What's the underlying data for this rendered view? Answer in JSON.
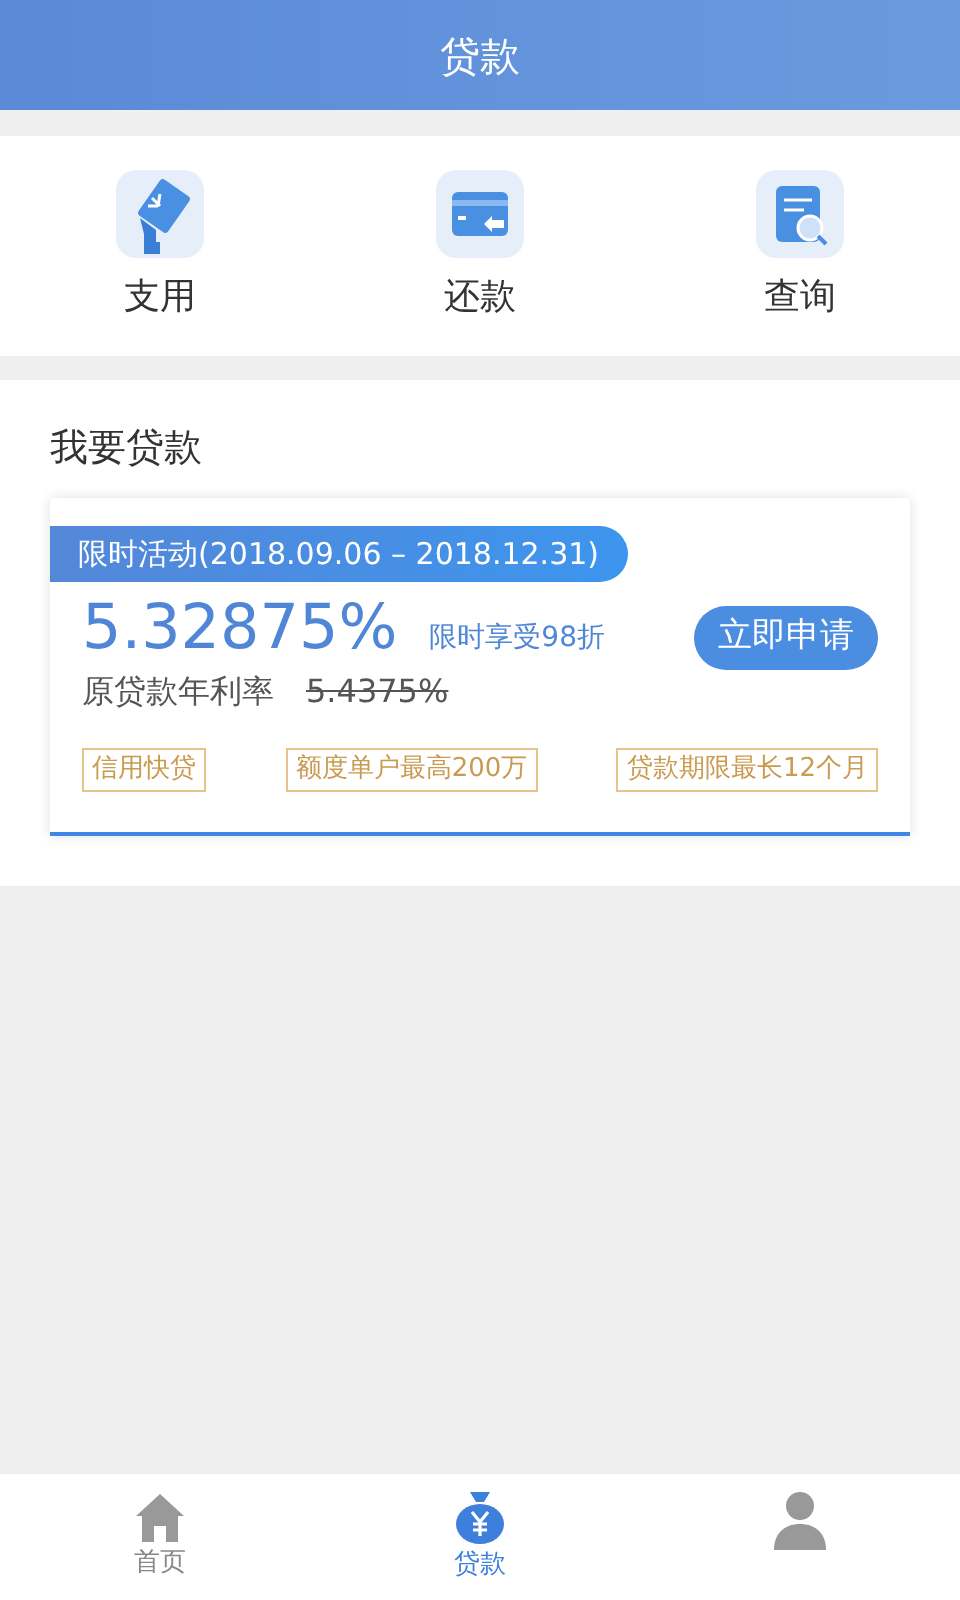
{
  "header": {
    "title": "贷款"
  },
  "actions": [
    {
      "label": "支用"
    },
    {
      "label": "还款"
    },
    {
      "label": "查询"
    }
  ],
  "loan_section": {
    "title": "我要贷款",
    "offer": {
      "promo": "限时活动(2018.09.06 – 2018.12.31)",
      "rate": "5.32875%",
      "discount": "限时享受98折",
      "apply_button": "立即申请",
      "original_label": "原贷款年利率",
      "original_rate": "5.4375%",
      "tags": [
        "信用快贷",
        "额度单户最高200万",
        "贷款期限最长12个月"
      ]
    }
  },
  "tabbar": [
    {
      "kind": "home",
      "label": "首页",
      "selected": false
    },
    {
      "kind": "loan",
      "label": "贷款",
      "selected": true
    },
    {
      "kind": "profile",
      "selected": false
    }
  ]
}
